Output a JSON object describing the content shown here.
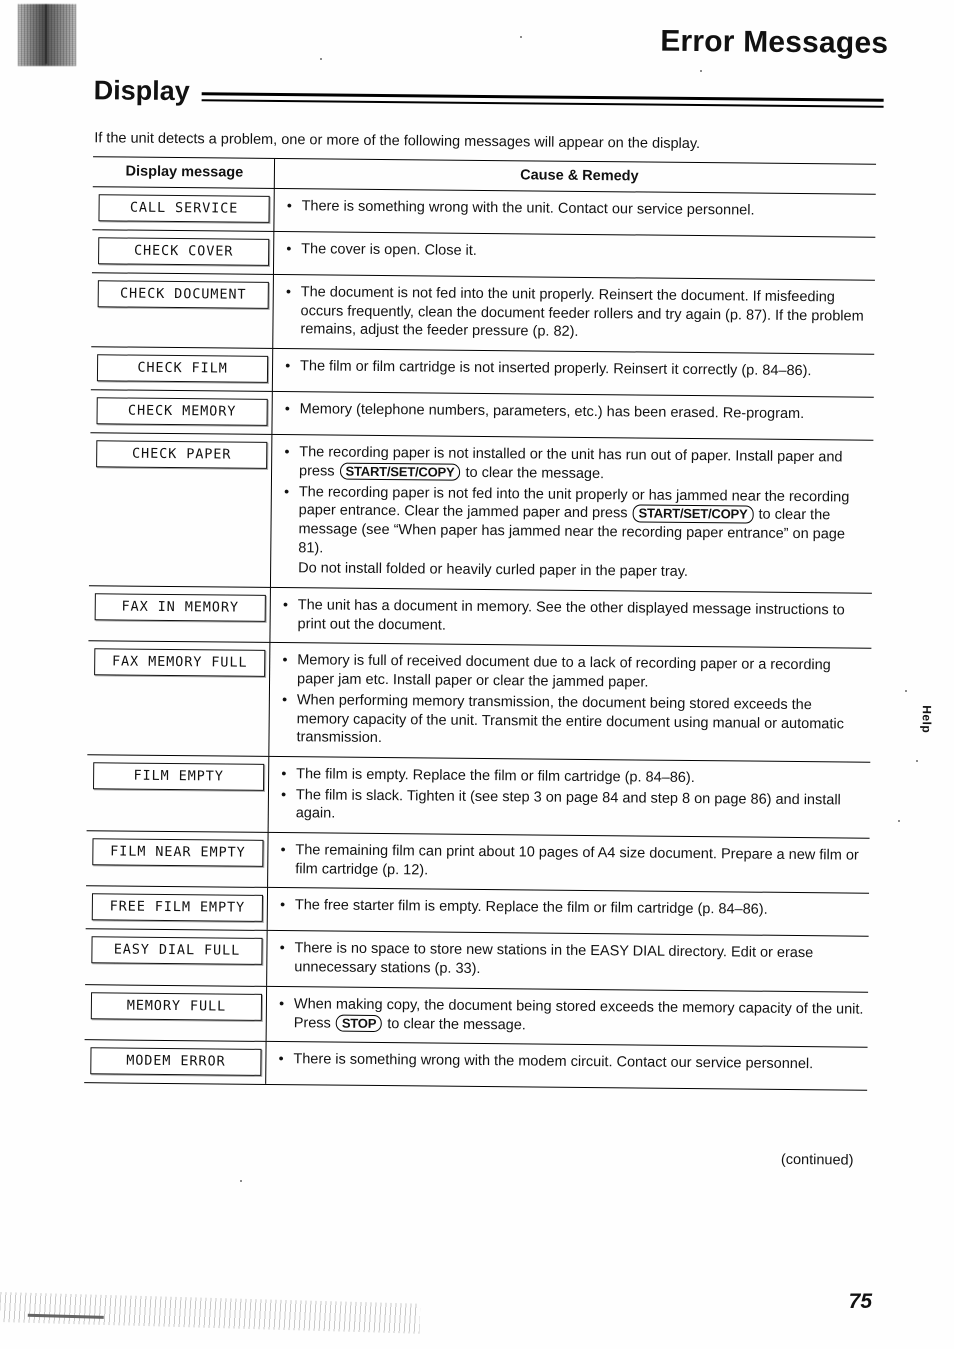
{
  "header": {
    "chapter_title": "Error Messages",
    "section_title": "Display",
    "intro": "If the unit detects a problem, one or more of the following messages will appear on the display."
  },
  "table": {
    "columns": {
      "message": "Display message",
      "cause": "Cause & Remedy"
    },
    "rows": [
      {
        "message": "CALL SERVICE",
        "causes": [
          {
            "parts": [
              {
                "t": "text",
                "v": "There is something wrong with the unit. Contact our service personnel."
              }
            ]
          }
        ]
      },
      {
        "message": "CHECK COVER",
        "causes": [
          {
            "parts": [
              {
                "t": "text",
                "v": "The cover is open. Close it."
              }
            ]
          }
        ]
      },
      {
        "message": "CHECK DOCUMENT",
        "causes": [
          {
            "parts": [
              {
                "t": "text",
                "v": "The document is not fed into the unit properly. Reinsert the document. If misfeeding occurs frequently, clean the document feeder rollers and try again (p. 87). If the problem remains, adjust the feeder pressure (p. 82)."
              }
            ]
          }
        ]
      },
      {
        "message": "CHECK FILM",
        "causes": [
          {
            "parts": [
              {
                "t": "text",
                "v": "The film or film cartridge is not inserted properly. Reinsert it correctly (p. 84–86)."
              }
            ]
          }
        ]
      },
      {
        "message": "CHECK MEMORY",
        "causes": [
          {
            "parts": [
              {
                "t": "text",
                "v": "Memory (telephone numbers, parameters, etc.) has been erased. Re-program."
              }
            ]
          }
        ]
      },
      {
        "message": "CHECK PAPER",
        "causes": [
          {
            "parts": [
              {
                "t": "text",
                "v": "The recording paper is not installed or the unit has run out of paper. Install paper and press "
              },
              {
                "t": "key",
                "v": "START/SET/COPY"
              },
              {
                "t": "text",
                "v": " to clear the message."
              }
            ]
          },
          {
            "parts": [
              {
                "t": "text",
                "v": "The recording paper is not fed into the unit properly or has jammed near the recording paper entrance. Clear the jammed paper and press "
              },
              {
                "t": "key",
                "v": "START/SET/COPY"
              },
              {
                "t": "text",
                "v": " to clear the message (see “When paper has jammed near the recording paper entrance” on page 81)."
              }
            ]
          },
          {
            "nobullet": true,
            "parts": [
              {
                "t": "text",
                "v": "Do not install folded or heavily curled paper in the paper tray."
              }
            ]
          }
        ]
      },
      {
        "message": "FAX IN MEMORY",
        "causes": [
          {
            "parts": [
              {
                "t": "text",
                "v": "The unit has a document in memory. See the other displayed message instructions to print out the document."
              }
            ]
          }
        ]
      },
      {
        "message": "FAX MEMORY FULL",
        "causes": [
          {
            "parts": [
              {
                "t": "text",
                "v": "Memory is full of received document due to a lack of recording paper or a recording paper jam etc. Install paper or clear the jammed paper."
              }
            ]
          },
          {
            "parts": [
              {
                "t": "text",
                "v": "When performing memory transmission, the document being stored exceeds the memory capacity of the unit. Transmit the entire document using manual or automatic transmission."
              }
            ]
          }
        ]
      },
      {
        "message": "FILM EMPTY",
        "causes": [
          {
            "parts": [
              {
                "t": "text",
                "v": "The film is empty. Replace the film or film cartridge (p. 84–86)."
              }
            ]
          },
          {
            "parts": [
              {
                "t": "text",
                "v": "The film is slack. Tighten it (see step 3 on page 84 and step 8 on page 86) and install again."
              }
            ]
          }
        ]
      },
      {
        "message": "FILM NEAR EMPTY",
        "causes": [
          {
            "parts": [
              {
                "t": "text",
                "v": "The remaining film can print about 10 pages of A4 size document. Prepare a new film or film cartridge (p. 12)."
              }
            ]
          }
        ]
      },
      {
        "message": "FREE FILM EMPTY",
        "causes": [
          {
            "parts": [
              {
                "t": "text",
                "v": "The free starter film is empty. Replace the film or film cartridge (p. 84–86)."
              }
            ]
          }
        ]
      },
      {
        "message": "EASY DIAL FULL",
        "causes": [
          {
            "parts": [
              {
                "t": "text",
                "v": "There is no space to store new stations in the EASY DIAL directory. Edit or erase unnecessary stations (p. 33)."
              }
            ]
          }
        ]
      },
      {
        "message": "MEMORY FULL",
        "causes": [
          {
            "parts": [
              {
                "t": "text",
                "v": "When making copy, the document being stored exceeds the memory capacity of the unit. Press "
              },
              {
                "t": "key",
                "v": "STOP"
              },
              {
                "t": "text",
                "v": " to clear the message."
              }
            ]
          }
        ]
      },
      {
        "message": "MODEM ERROR",
        "causes": [
          {
            "parts": [
              {
                "t": "text",
                "v": "There is something wrong with the modem circuit. Contact our service personnel."
              }
            ]
          }
        ]
      }
    ]
  },
  "side_tab": "Help",
  "footer": {
    "continued": "(continued)",
    "page_number": "75"
  }
}
